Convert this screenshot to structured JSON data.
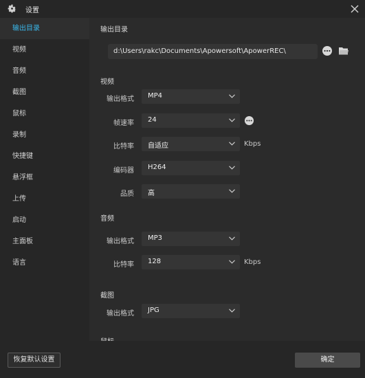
{
  "window": {
    "title": "设置"
  },
  "sidebar": {
    "items": [
      {
        "label": "输出目录",
        "active": true
      },
      {
        "label": "视频"
      },
      {
        "label": "音频"
      },
      {
        "label": "截图"
      },
      {
        "label": "鼠标"
      },
      {
        "label": "录制"
      },
      {
        "label": "快捷键"
      },
      {
        "label": "悬浮框"
      },
      {
        "label": "上传"
      },
      {
        "label": "启动"
      },
      {
        "label": "主面板"
      },
      {
        "label": "语言"
      }
    ]
  },
  "output": {
    "section_title": "输出目录",
    "path": "d:\\Users\\rakc\\Documents\\Apowersoft\\ApowerREC\\"
  },
  "video": {
    "section_title": "视频",
    "format": {
      "label": "输出格式",
      "value": "MP4"
    },
    "fps": {
      "label": "帧速率",
      "value": "24"
    },
    "bitrate": {
      "label": "比特率",
      "value": "自适应",
      "unit": "Kbps"
    },
    "encoder": {
      "label": "编码器",
      "value": "H264"
    },
    "quality": {
      "label": "品质",
      "value": "高"
    }
  },
  "audio": {
    "section_title": "音频",
    "format": {
      "label": "输出格式",
      "value": "MP3"
    },
    "bitrate": {
      "label": "比特率",
      "value": "128",
      "unit": "Kbps"
    }
  },
  "screenshot": {
    "section_title": "截图",
    "format": {
      "label": "输出格式",
      "value": "JPG"
    }
  },
  "mouse": {
    "section_title": "鼠标"
  },
  "footer": {
    "reset_label": "恢复默认设置",
    "ok_label": "确定"
  },
  "colors": {
    "accent": "#3ab7ea",
    "background": "#2b2b2b",
    "sidebar": "#262626",
    "control": "#353535"
  },
  "icons": {
    "title": "gear-icon",
    "close": "close-icon",
    "more": "more-icon",
    "folder": "folder-icon",
    "dropdown": "chevron-down-icon"
  }
}
